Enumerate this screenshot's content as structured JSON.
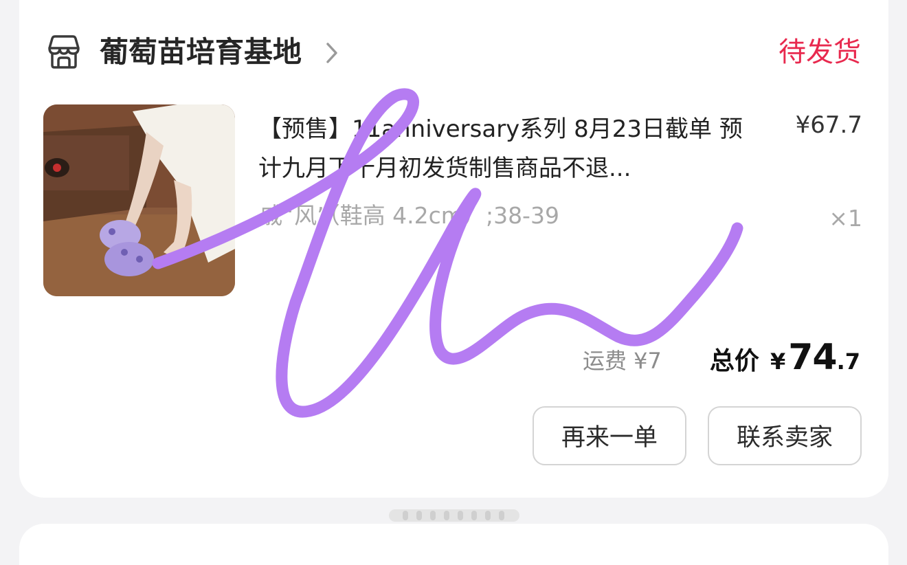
{
  "store": {
    "name": "葡萄苗培育基地",
    "icon": "store-icon",
    "chevron_icon": "chevron-right-icon"
  },
  "order": {
    "status": "待发货",
    "status_color": "#e8294e"
  },
  "product": {
    "image": "product-thumbnail-lilac-clogs",
    "title": "【预售】11anniversary系列  8月23日截单 预计九月下十月初发货制售商品不退...",
    "price": "¥67.7",
    "variant": "戚“风”（鞋高 4.2cm）;38-39",
    "quantity": "×1"
  },
  "summary": {
    "shipping": "运费 ¥7",
    "total_label": "总价",
    "currency": "¥",
    "total_integer": "74",
    "total_decimal": ".7"
  },
  "actions": {
    "reorder": "再来一单",
    "contact_seller": "联系卖家"
  },
  "annotation": {
    "color": "#b57cf2",
    "icon": "handwritten-scribble"
  }
}
